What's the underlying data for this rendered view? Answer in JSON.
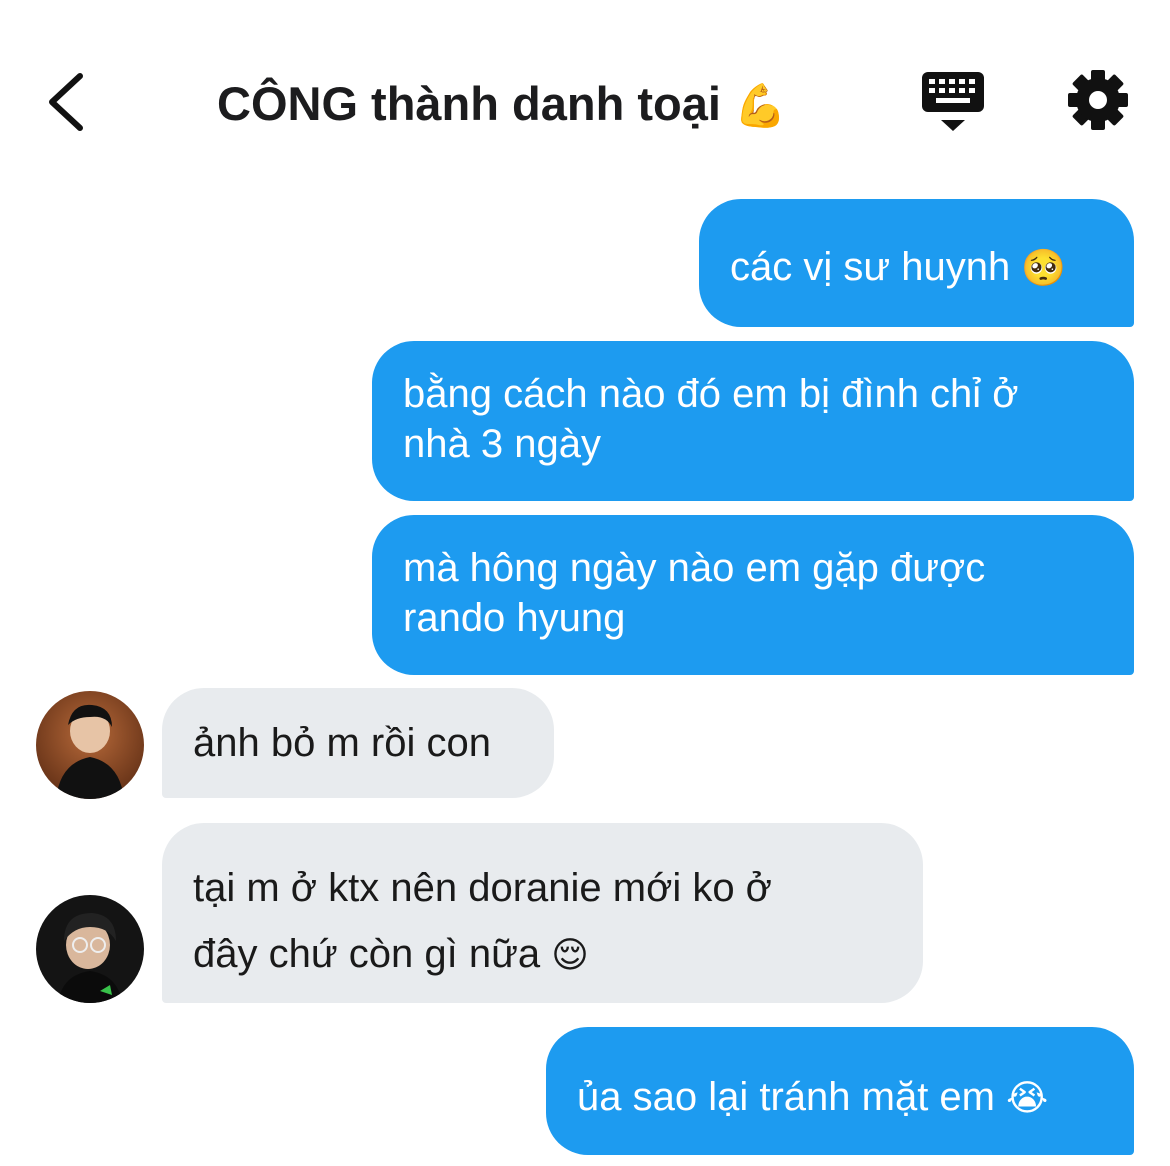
{
  "header": {
    "title": "CÔNG thành danh toại",
    "title_emoji": "💪",
    "back_icon": "chevron-left-icon",
    "keyboard_icon": "keyboard-icon",
    "settings_icon": "gear-icon"
  },
  "colors": {
    "outgoing_bubble": "#1d9bf0",
    "incoming_bubble": "#e8ebee",
    "outgoing_text": "#ffffff",
    "incoming_text": "#1a1a1a"
  },
  "messages": [
    {
      "direction": "outgoing",
      "lines": [
        "các vị sư huynh"
      ],
      "emoji": "🥺"
    },
    {
      "direction": "outgoing",
      "lines": [
        "bằng cách nào đó em bị đình chỉ ở",
        "nhà 3 ngày"
      ]
    },
    {
      "direction": "outgoing",
      "lines": [
        "mà hông ngày nào em gặp được",
        "rando hyung"
      ]
    },
    {
      "direction": "incoming",
      "lines": [
        "ảnh bỏ m rồi con"
      ],
      "avatar": "avatar-1"
    },
    {
      "direction": "incoming",
      "lines": [
        "tại m ở ktx nên doranie mới ko ở",
        "đây chứ còn gì nữa"
      ],
      "emoji": "😌",
      "avatar": "avatar-2"
    },
    {
      "direction": "outgoing",
      "lines": [
        "ủa sao lại tránh mặt em"
      ],
      "emoji": "😭"
    }
  ]
}
